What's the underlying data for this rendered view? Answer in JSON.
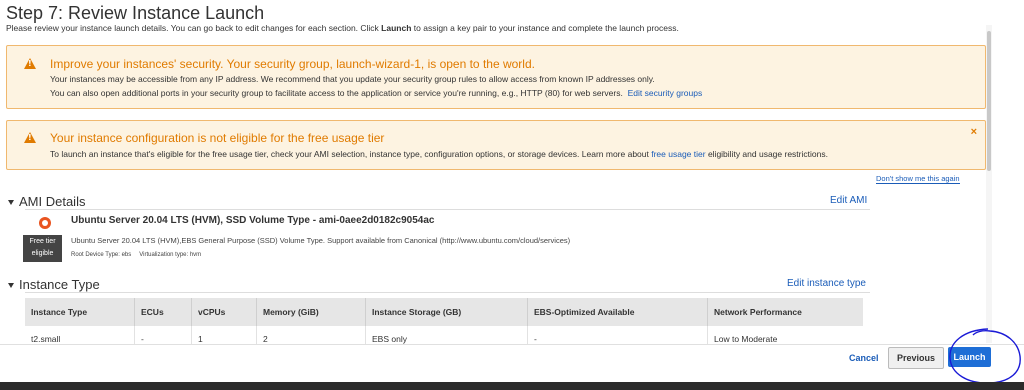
{
  "header": {
    "title": "Step 7: Review Instance Launch",
    "desc_prefix": "Please review your instance launch details. You can go back to edit changes for each section. Click ",
    "desc_bold": "Launch",
    "desc_suffix": " to assign a key pair to your instance and complete the launch process."
  },
  "warning_security": {
    "title": "Improve your instances' security. Your security group, launch-wizard-1, is open to the world.",
    "line1": "Your instances may be accessible from any IP address. We recommend that you update your security group rules to allow access from known IP addresses only.",
    "line2": "You can also open additional ports in your security group to facilitate access to the application or service you're running, e.g., HTTP (80) for web servers.",
    "link": "Edit security groups"
  },
  "warning_freetier": {
    "title": "Your instance configuration is not eligible for the free usage tier",
    "line_prefix": "To launch an instance that's eligible for the free usage tier, check your AMI selection, instance type, configuration options, or storage devices. Learn more about ",
    "link": "free usage tier",
    "line_suffix": " eligibility and usage restrictions.",
    "close": "×",
    "dont_show": "Don't show me this again"
  },
  "ami": {
    "section_title": "AMI Details",
    "edit_link": "Edit AMI",
    "name": "Ubuntu Server 20.04 LTS (HVM), SSD Volume Type - ami-0aee2d0182c9054ac",
    "description": "Ubuntu Server 20.04 LTS (HVM),EBS General Purpose (SSD) Volume Type. Support available from Canonical (http://www.ubuntu.com/cloud/services)",
    "root_device": "Root Device Type: ebs",
    "virtualization": "Virtualization type: hvm",
    "badge_line1": "Free tier",
    "badge_line2": "eligible"
  },
  "instance_type": {
    "section_title": "Instance Type",
    "edit_link": "Edit instance type",
    "columns": [
      "Instance Type",
      "ECUs",
      "vCPUs",
      "Memory (GiB)",
      "Instance Storage (GB)",
      "EBS-Optimized Available",
      "Network Performance"
    ],
    "row": [
      "t2.small",
      "-",
      "1",
      "2",
      "EBS only",
      "-",
      "Low to Moderate"
    ]
  },
  "footer": {
    "cancel": "Cancel",
    "previous": "Previous",
    "launch": "Launch"
  },
  "colors": {
    "accent": "#1e6ed6",
    "warning": "#e07b00",
    "annotation": "#1a1ad6"
  }
}
